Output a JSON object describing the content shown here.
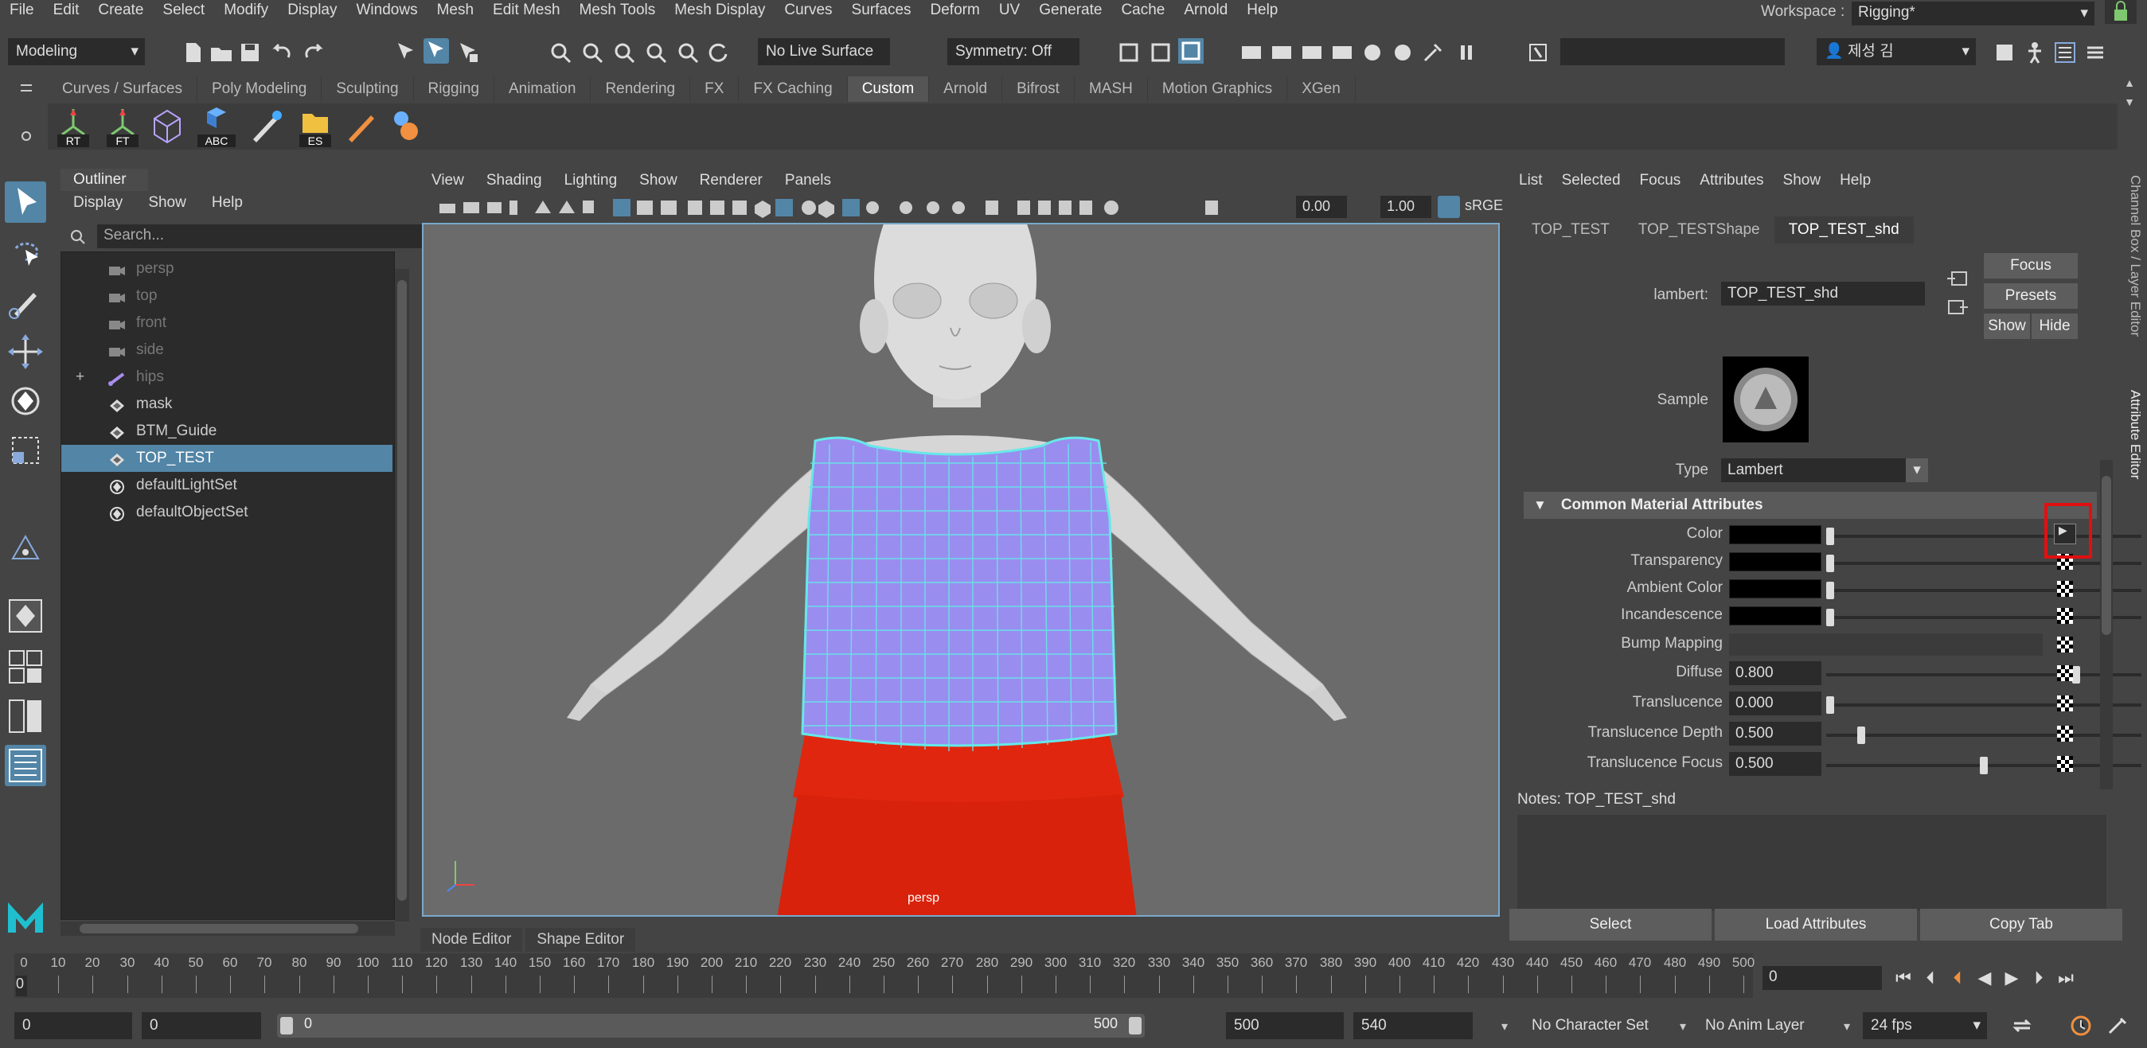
{
  "menubar": {
    "items": [
      "File",
      "Edit",
      "Create",
      "Select",
      "Modify",
      "Display",
      "Windows",
      "Mesh",
      "Edit Mesh",
      "Mesh Tools",
      "Mesh Display",
      "Curves",
      "Surfaces",
      "Deform",
      "UV",
      "Generate",
      "Cache",
      "Arnold",
      "Help"
    ],
    "workspace_label": "Workspace :",
    "workspace_value": "Rigging*"
  },
  "statusline": {
    "mode": "Modeling",
    "live_surface": "No Live Surface",
    "symmetry": "Symmetry: Off",
    "user": "제성 김"
  },
  "shelf": {
    "tabs": [
      "Curves / Surfaces",
      "Poly Modeling",
      "Sculpting",
      "Rigging",
      "Animation",
      "Rendering",
      "FX",
      "FX Caching",
      "Custom",
      "Arnold",
      "Bifrost",
      "MASH",
      "Motion Graphics",
      "XGen"
    ],
    "active_tab": "Custom",
    "button_labels": [
      "RT",
      "FT",
      "",
      "ABC",
      "",
      "ES",
      "",
      ""
    ]
  },
  "outliner": {
    "title": "Outliner",
    "menu": [
      "Display",
      "Show",
      "Help"
    ],
    "search_placeholder": "Search...",
    "items": [
      {
        "label": "persp",
        "icon": "camera-icon",
        "dim": true
      },
      {
        "label": "top",
        "icon": "camera-icon",
        "dim": true
      },
      {
        "label": "front",
        "icon": "camera-icon",
        "dim": true
      },
      {
        "label": "side",
        "icon": "camera-icon",
        "dim": true
      },
      {
        "label": "hips",
        "icon": "joint-icon",
        "dim": true,
        "expand": "+"
      },
      {
        "label": "mask",
        "icon": "transform-icon"
      },
      {
        "label": "BTM_Guide",
        "icon": "transform-icon"
      },
      {
        "label": "TOP_TEST",
        "icon": "transform-icon",
        "selected": true
      },
      {
        "label": "defaultLightSet",
        "icon": "set-icon"
      },
      {
        "label": "defaultObjectSet",
        "icon": "set-icon"
      }
    ]
  },
  "viewport": {
    "menu": [
      "View",
      "Shading",
      "Lighting",
      "Show",
      "Renderer",
      "Panels"
    ],
    "field_a": "0.00",
    "field_b": "1.00",
    "colorspace": "sRGE",
    "camera_label": "persp",
    "bottom_tabs": [
      "Node Editor",
      "Shape Editor"
    ]
  },
  "attribute_editor": {
    "menu": [
      "List",
      "Selected",
      "Focus",
      "Attributes",
      "Show",
      "Help"
    ],
    "tabs": [
      "TOP_TEST",
      "TOP_TESTShape",
      "TOP_TEST_shd"
    ],
    "active_tab": "TOP_TEST_shd",
    "node_type_label": "lambert:",
    "node_name": "TOP_TEST_shd",
    "focus": "Focus",
    "presets": "Presets",
    "show": "Show",
    "hide": "Hide",
    "sample_label": "Sample",
    "type_label": "Type",
    "type_value": "Lambert",
    "section_title": "Common Material Attributes",
    "attrs": [
      {
        "label": "Color",
        "kind": "swatch",
        "slider": 0.0
      },
      {
        "label": "Transparency",
        "kind": "swatch",
        "slider": 0.0
      },
      {
        "label": "Ambient Color",
        "kind": "swatch",
        "slider": 0.0
      },
      {
        "label": "Incandescence",
        "kind": "swatch",
        "slider": 0.0
      },
      {
        "label": "Bump Mapping",
        "kind": "bump"
      },
      {
        "label": "Diffuse",
        "kind": "num",
        "value": "0.800",
        "slider": 0.8
      },
      {
        "label": "Translucence",
        "kind": "num",
        "value": "0.000",
        "slider": 0.0
      },
      {
        "label": "Translucence Depth",
        "kind": "num",
        "value": "0.500",
        "slider": 0.1
      },
      {
        "label": "Translucence Focus",
        "kind": "num",
        "value": "0.500",
        "slider": 0.5
      }
    ],
    "notes_label": "Notes:  TOP_TEST_shd",
    "bottom_buttons": [
      "Select",
      "Load Attributes",
      "Copy Tab"
    ]
  },
  "side_tabs": [
    "Channel Box / Layer Editor",
    "Attribute Editor"
  ],
  "timeline": {
    "ticks": [
      0,
      10,
      20,
      30,
      40,
      50,
      60,
      70,
      80,
      90,
      100,
      110,
      120,
      130,
      140,
      150,
      160,
      170,
      180,
      190,
      200,
      210,
      220,
      230,
      240,
      250,
      260,
      270,
      280,
      290,
      300,
      310,
      320,
      330,
      340,
      350,
      360,
      370,
      380,
      390,
      400,
      410,
      420,
      430,
      440,
      450,
      460,
      470,
      480,
      490,
      500
    ],
    "current_frame_marker": "0",
    "current_frame_field": "0"
  },
  "range": {
    "start": "0",
    "playback_start": "0",
    "slider_start": "0",
    "slider_end": "500",
    "playback_end": "500",
    "end": "540",
    "character_set": "No Character Set",
    "anim_layer": "No Anim Layer",
    "fps": "24 fps"
  },
  "colors": {
    "accent": "#5285a6",
    "skirt": "#e0260e",
    "shirt": "#9a8df0",
    "wire": "#66e8e8",
    "highlight": "#e01010"
  }
}
